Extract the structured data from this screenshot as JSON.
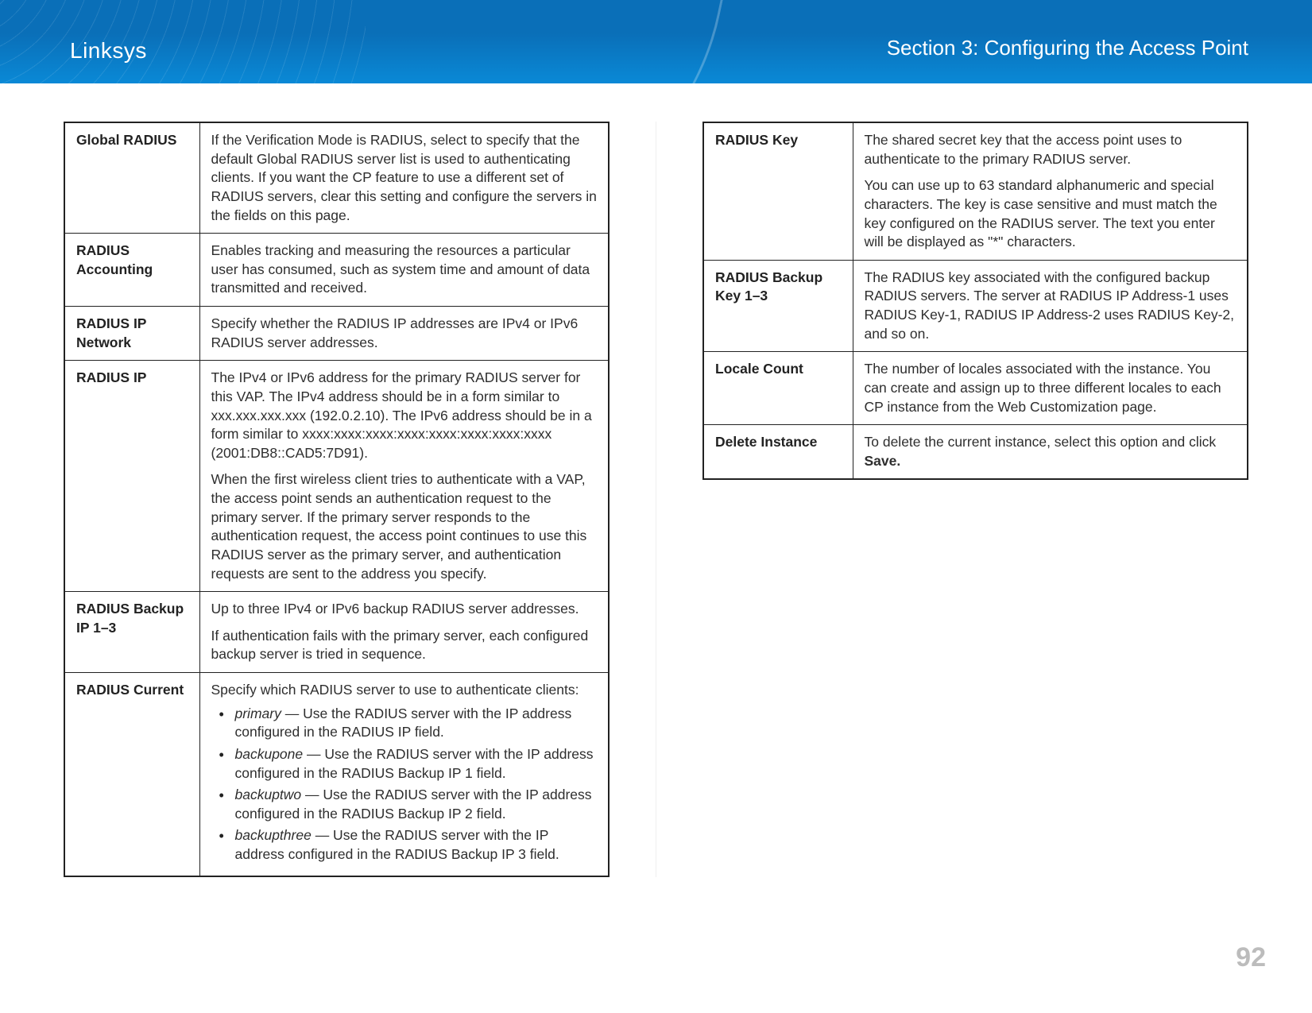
{
  "header": {
    "brand": "Linksys",
    "section": "Section 3:  Configuring the Access Point"
  },
  "page_number": "92",
  "table_left": [
    {
      "label": "Global RADIUS",
      "blocks": [
        {
          "type": "p",
          "text": "If the Verification Mode is RADIUS, select to specify that the default Global RADIUS server list is used to authenticating clients. If you want the CP feature to use a different set of RADIUS servers, clear this setting and configure the servers in the fields on this page."
        }
      ]
    },
    {
      "label": "RADIUS Accounting",
      "blocks": [
        {
          "type": "p",
          "text": "Enables tracking and measuring the resources a particular user has consumed, such as system time and amount of data transmitted and received."
        }
      ]
    },
    {
      "label": "RADIUS IP Network",
      "blocks": [
        {
          "type": "p",
          "text": "Specify whether the RADIUS IP addresses are IPv4 or IPv6 RADIUS server addresses."
        }
      ]
    },
    {
      "label": "RADIUS IP",
      "blocks": [
        {
          "type": "p",
          "text": "The IPv4 or IPv6 address for the primary RADIUS server for this VAP. The IPv4 address should be in a form similar to xxx.xxx.xxx.xxx (192.0.2.10). The IPv6 address should be in a form similar to xxxx:xxxx:xxxx:xxxx:xxxx:xxxx:xxxx:xxxx (2001:DB8::CAD5:7D91)."
        },
        {
          "type": "p",
          "text": "When the first wireless client tries to authenticate with a VAP, the access point sends an authentication request to the primary server. If the primary server responds to the authentication request, the access point continues to use this RADIUS server as the primary server, and authentication requests are sent to the address you specify."
        }
      ]
    },
    {
      "label": "RADIUS Backup IP 1–3",
      "blocks": [
        {
          "type": "p",
          "text": "Up to three IPv4 or IPv6 backup RADIUS server addresses."
        },
        {
          "type": "p",
          "text": "If authentication fails with the primary server, each configured backup server is tried in sequence."
        }
      ]
    },
    {
      "label": "RADIUS Current",
      "blocks": [
        {
          "type": "p",
          "text": "Specify which RADIUS server to use to authenticate clients:"
        },
        {
          "type": "ul",
          "items": [
            {
              "term": "primary",
              "rest": " — Use the RADIUS server with the IP address configured in the RADIUS IP field."
            },
            {
              "term": "backupone",
              "rest": " — Use the RADIUS server with the IP address configured in the RADIUS Backup IP 1 field."
            },
            {
              "term": "backuptwo",
              "rest": " — Use the RADIUS server with the IP address configured in the RADIUS Backup IP 2 field."
            },
            {
              "term": "backupthree",
              "rest": " — Use the RADIUS server with the IP address configured in the RADIUS Backup IP 3 field."
            }
          ]
        }
      ]
    }
  ],
  "table_right": [
    {
      "label": "RADIUS Key",
      "blocks": [
        {
          "type": "p",
          "text": "The shared secret key that the access point uses to authenticate to the primary RADIUS server."
        },
        {
          "type": "p",
          "text": "You can use up to 63 standard alphanumeric and special characters. The key is case sensitive and must match the key configured on the RADIUS server. The text you enter will be displayed as \"*\" characters."
        }
      ]
    },
    {
      "label": "RADIUS Backup Key 1–3",
      "blocks": [
        {
          "type": "p",
          "text": "The RADIUS key associated with the configured backup RADIUS servers. The server at RADIUS IP Address-1 uses RADIUS Key-1, RADIUS IP Address-2 uses RADIUS Key-2, and so on."
        }
      ]
    },
    {
      "label": "Locale Count",
      "blocks": [
        {
          "type": "p",
          "text": "The number of locales associated with the instance. You can create and assign up to three different locales to each CP instance from the Web Customization page."
        }
      ]
    },
    {
      "label": "Delete Instance",
      "blocks": [
        {
          "type": "p_mixed",
          "parts": [
            {
              "text": "To delete the current instance, select this option and click "
            },
            {
              "text": "Save.",
              "bold": true
            }
          ]
        }
      ]
    }
  ]
}
